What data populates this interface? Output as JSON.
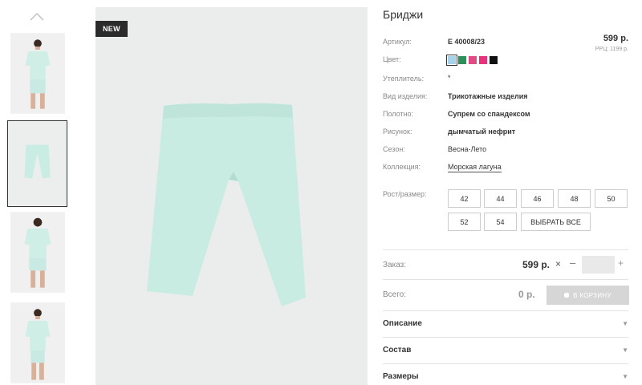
{
  "badge": "NEW",
  "product": {
    "title": "Бриджи"
  },
  "attributes": [
    {
      "label": "Артикул:",
      "value": "Е 40008/23",
      "bold": true
    },
    {
      "label": "Цвет:",
      "value": ""
    },
    {
      "label": "Утеплитель:",
      "value": "*"
    },
    {
      "label": "Вид изделия:",
      "value": "Трикотажные изделия",
      "bold": true
    },
    {
      "label": "Полотно:",
      "value": "Супрем со спандексом",
      "bold": true
    },
    {
      "label": "Рисунок:",
      "value": "дымчатый нефрит",
      "bold": true
    },
    {
      "label": "Сезон:",
      "value": "Весна-Лето"
    },
    {
      "label": "Коллекция:",
      "value": "Морская лагуна"
    }
  ],
  "price": "599 р.",
  "rrp": "РРЦ: 1199 р.",
  "colors": [
    {
      "name": "light-blue",
      "hex": "#a7d3ea",
      "active": true
    },
    {
      "name": "green",
      "hex": "#2e8f5a"
    },
    {
      "name": "pink",
      "hex": "#e24a86"
    },
    {
      "name": "magenta",
      "hex": "#e8327a"
    },
    {
      "name": "black",
      "hex": "#111111"
    }
  ],
  "sizes": {
    "label": "Рост/размер:",
    "options": [
      "42",
      "44",
      "46",
      "48",
      "50",
      "52",
      "54"
    ],
    "select_all": "ВЫБРАТЬ ВСЕ"
  },
  "order": {
    "label": "Заказ:",
    "price": "599 р.",
    "close": "×",
    "minus": "–",
    "plus": "+"
  },
  "total": {
    "label": "Всего:",
    "value": "0 р.",
    "cart_button": "В КОРЗИНУ"
  },
  "accordion": [
    {
      "title": "Описание",
      "arrow": "▼"
    },
    {
      "title": "Состав",
      "arrow": "▼"
    },
    {
      "title": "Размеры",
      "arrow": "▼"
    }
  ]
}
